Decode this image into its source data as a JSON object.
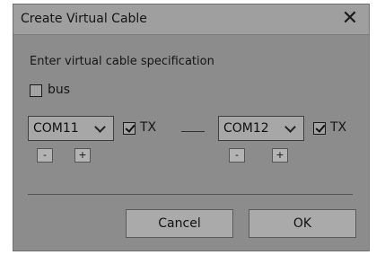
{
  "dialog": {
    "title": "Create Virtual Cable",
    "close_glyph": "✕",
    "heading": "Enter virtual cable specification",
    "bus_label": "bus",
    "left_port": {
      "value": "COM11",
      "tx_label": "TX",
      "minus_label": "-",
      "plus_label": "+"
    },
    "right_port": {
      "value": "COM12",
      "tx_label": "TX",
      "minus_label": "-",
      "plus_label": "+"
    },
    "cancel_label": "Cancel",
    "ok_label": "OK"
  }
}
